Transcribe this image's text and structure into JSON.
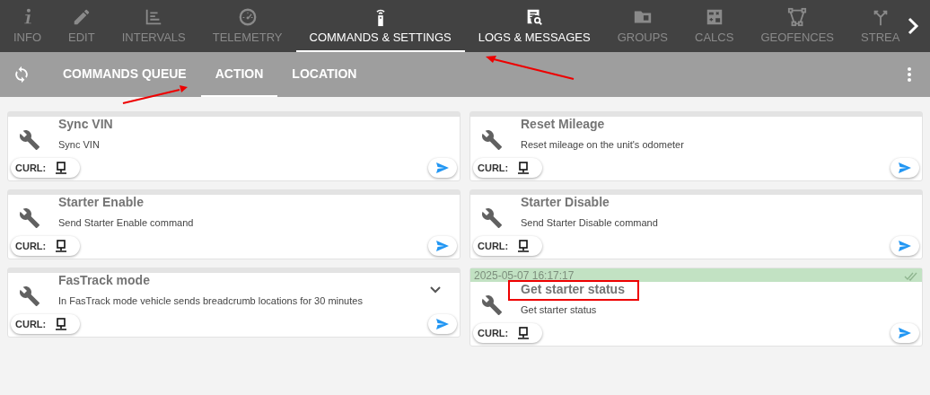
{
  "nav_tabs": [
    {
      "label": "INFO",
      "selected": false,
      "enabled": false
    },
    {
      "label": "EDIT",
      "selected": false,
      "enabled": false
    },
    {
      "label": "INTERVALS",
      "selected": false,
      "enabled": false
    },
    {
      "label": "TELEMETRY",
      "selected": false,
      "enabled": false
    },
    {
      "label": "COMMANDS & SETTINGS",
      "selected": true,
      "enabled": true
    },
    {
      "label": "LOGS & MESSAGES",
      "selected": false,
      "enabled": true
    },
    {
      "label": "GROUPS",
      "selected": false,
      "enabled": false
    },
    {
      "label": "CALCS",
      "selected": false,
      "enabled": false
    },
    {
      "label": "GEOFENCES",
      "selected": false,
      "enabled": false
    },
    {
      "label": "STREA",
      "selected": false,
      "enabled": false
    }
  ],
  "sub_tabs": [
    {
      "label": "COMMANDS QUEUE",
      "selected": false
    },
    {
      "label": "ACTION",
      "selected": true
    },
    {
      "label": "LOCATION",
      "selected": false
    }
  ],
  "commands": [
    {
      "title": "Sync VIN",
      "description": "Sync VIN",
      "curl_label": "CURL:",
      "expandable": false,
      "highlighted": false
    },
    {
      "title": "Reset Mileage",
      "description": "Reset mileage on the unit's odometer",
      "curl_label": "CURL:",
      "expandable": false,
      "highlighted": false
    },
    {
      "title": "Starter Enable",
      "description": "Send Starter Enable command",
      "curl_label": "CURL:",
      "expandable": false,
      "highlighted": false
    },
    {
      "title": "Starter Disable",
      "description": "Send Starter Disable command",
      "curl_label": "CURL:",
      "expandable": false,
      "highlighted": false
    },
    {
      "title": "FasTrack mode",
      "description": "In FasTrack mode vehicle sends breadcrumb locations for 30 minutes",
      "curl_label": "CURL:",
      "expandable": true,
      "highlighted": false
    },
    {
      "title": "Get starter status",
      "description": "Get starter status",
      "curl_label": "CURL:",
      "expandable": false,
      "highlighted": true,
      "timestamp": "2025-05-07 16:17:17",
      "delivered": true
    }
  ]
}
